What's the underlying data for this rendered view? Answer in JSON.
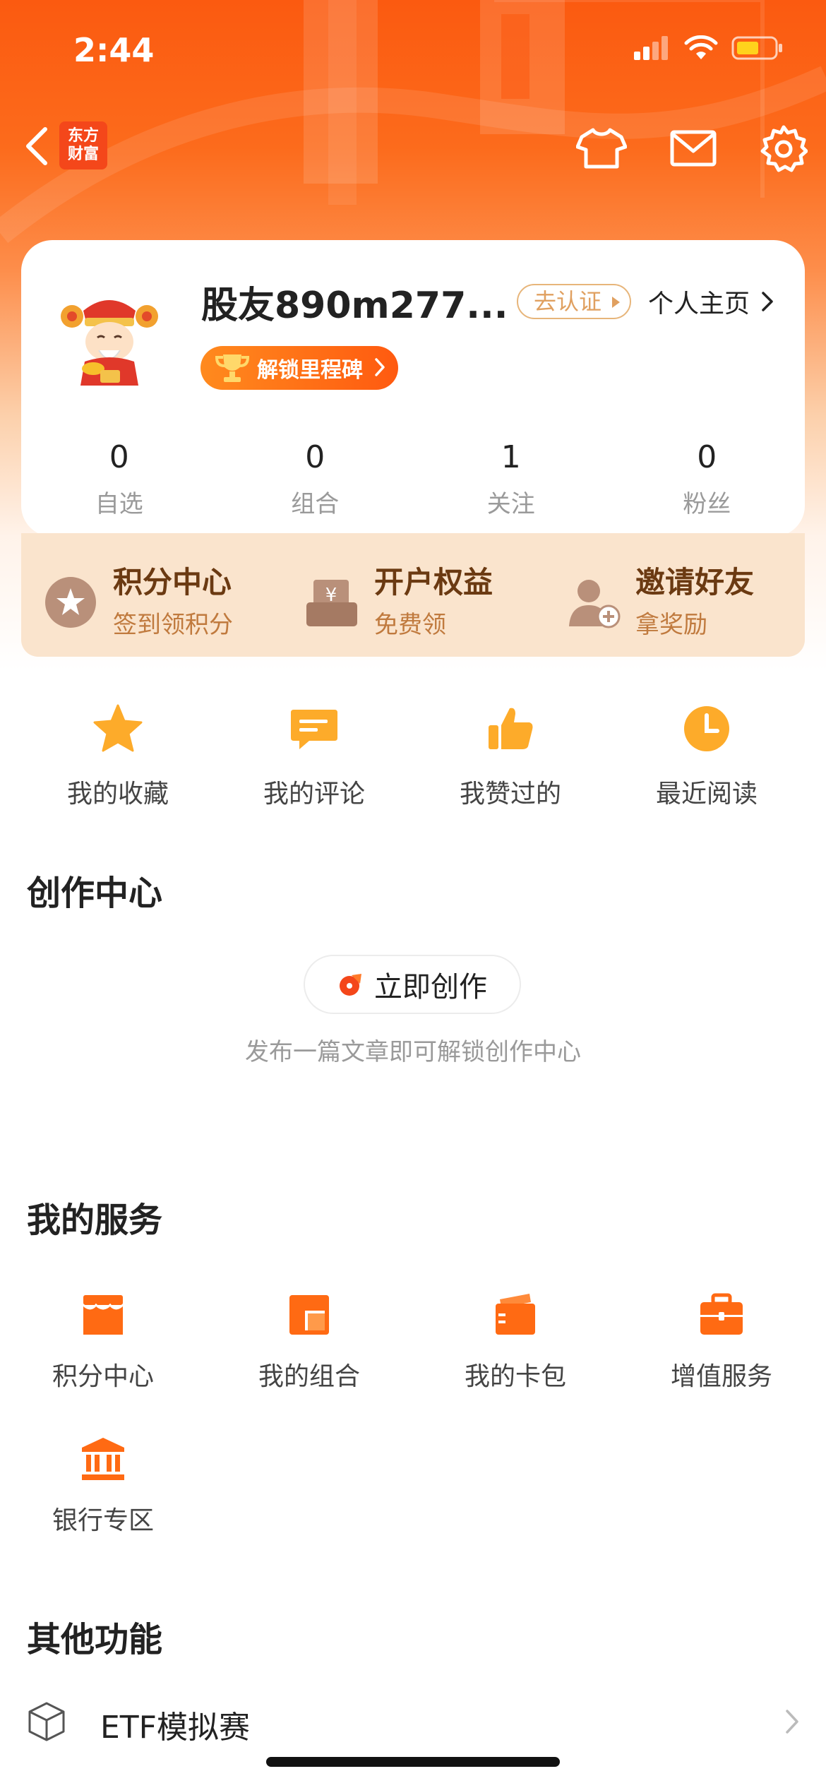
{
  "status_bar": {
    "time": "2:44"
  },
  "nav": {
    "brand_line1": "东方",
    "brand_line2": "财富"
  },
  "profile": {
    "username": "股友890m277...",
    "verify_label": "去认证",
    "homepage_label": "个人主页",
    "milestone_label": "解锁里程碑",
    "stats": [
      {
        "value": "0",
        "label": "自选"
      },
      {
        "value": "0",
        "label": "组合"
      },
      {
        "value": "1",
        "label": "关注"
      },
      {
        "value": "0",
        "label": "粉丝"
      }
    ]
  },
  "benefits": [
    {
      "title": "积分中心",
      "subtitle": "签到领积分",
      "icon": "star-badge-icon"
    },
    {
      "title": "开户权益",
      "subtitle": "免费领",
      "icon": "yuan-box-icon"
    },
    {
      "title": "邀请好友",
      "subtitle": "拿奖励",
      "icon": "add-friend-icon"
    }
  ],
  "quick_actions": [
    {
      "label": "我的收藏",
      "icon": "star-icon"
    },
    {
      "label": "我的评论",
      "icon": "comment-icon"
    },
    {
      "label": "我赞过的",
      "icon": "thumbs-up-icon"
    },
    {
      "label": "最近阅读",
      "icon": "clock-icon"
    }
  ],
  "create_center": {
    "title": "创作中心",
    "button_label": "立即创作",
    "hint": "发布一篇文章即可解锁创作中心"
  },
  "services": {
    "title": "我的服务",
    "items": [
      {
        "label": "积分中心",
        "icon": "store-icon"
      },
      {
        "label": "我的组合",
        "icon": "portfolio-icon"
      },
      {
        "label": "我的卡包",
        "icon": "card-wallet-icon"
      },
      {
        "label": "增值服务",
        "icon": "briefcase-icon"
      },
      {
        "label": "银行专区",
        "icon": "bank-icon"
      }
    ]
  },
  "other": {
    "title": "其他功能",
    "etf_label": "ETF模拟赛"
  },
  "colors": {
    "accent": "#ff6a13",
    "brand_red": "#f4471a",
    "benefit_bg": "#fae4cd"
  }
}
